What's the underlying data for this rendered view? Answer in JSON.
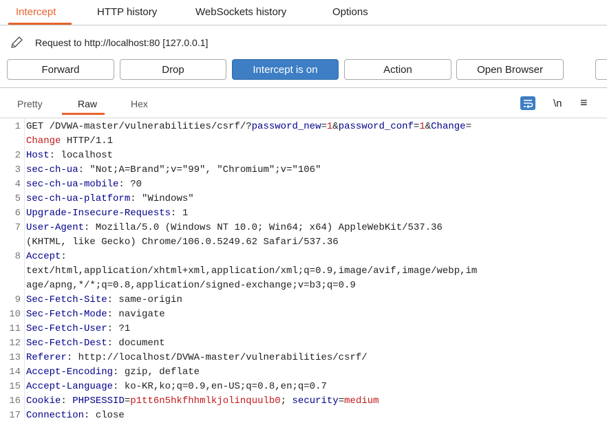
{
  "tabs": {
    "intercept": "Intercept",
    "http_history": "HTTP history",
    "websockets_history": "WebSockets history",
    "options": "Options"
  },
  "request": {
    "label": "Request to http://localhost:80  [127.0.0.1]"
  },
  "buttons": {
    "forward": "Forward",
    "drop": "Drop",
    "intercept": "Intercept is on",
    "action": "Action",
    "open_browser": "Open Browser"
  },
  "view_tabs": {
    "pretty": "Pretty",
    "raw": "Raw",
    "hex": "Hex",
    "newline": "\\n",
    "menu": "≡"
  },
  "editor": {
    "line1": {
      "method": "GET /DVWA-master/vulnerabilities/csrf/?",
      "p1": "password_new",
      "eq1": "=",
      "v1": "1",
      "amp1": "&",
      "p2": "password_conf",
      "eq2": "=",
      "v2": "1",
      "amp2": "&",
      "p3": "Change",
      "eq3": "="
    },
    "line1b": {
      "v3": "Change",
      "rest": " HTTP/1.1"
    },
    "headers": [
      {
        "n": "2",
        "k": "Host",
        "v": " localhost"
      },
      {
        "n": "3",
        "k": "sec-ch-ua",
        "v": " \"Not;A=Brand\";v=\"99\", \"Chromium\";v=\"106\""
      },
      {
        "n": "4",
        "k": "sec-ch-ua-mobile",
        "v": " ?0"
      },
      {
        "n": "5",
        "k": "sec-ch-ua-platform",
        "v": " \"Windows\""
      },
      {
        "n": "6",
        "k": "Upgrade-Insecure-Requests",
        "v": " 1"
      },
      {
        "n": "7",
        "k": "User-Agent",
        "v": " Mozilla/5.0 (Windows NT 10.0; Win64; x64) AppleWebKit/537.36"
      }
    ],
    "ua_cont": "(KHTML, like Gecko) Chrome/106.0.5249.62 Safari/537.36",
    "accept_key": "Accept",
    "accept_l1": "text/html,application/xhtml+xml,application/xml;q=0.9,image/avif,image/webp,im",
    "accept_l2": "age/apng,*/*;q=0.8,application/signed-exchange;v=b3;q=0.9",
    "headers2": [
      {
        "n": "9",
        "k": "Sec-Fetch-Site",
        "v": " same-origin"
      },
      {
        "n": "10",
        "k": "Sec-Fetch-Mode",
        "v": " navigate"
      },
      {
        "n": "11",
        "k": "Sec-Fetch-User",
        "v": " ?1"
      },
      {
        "n": "12",
        "k": "Sec-Fetch-Dest",
        "v": " document"
      },
      {
        "n": "13",
        "k": "Referer",
        "v": " http://localhost/DVWA-master/vulnerabilities/csrf/"
      },
      {
        "n": "14",
        "k": "Accept-Encoding",
        "v": " gzip, deflate"
      },
      {
        "n": "15",
        "k": "Accept-Language",
        "v": " ko-KR,ko;q=0.9,en-US;q=0.8,en;q=0.7"
      }
    ],
    "cookie": {
      "k": "Cookie",
      "c1k": "PHPSESSID",
      "c1v": "p1tt6n5hkfhhmlkjolinquulb0",
      "sep": "; ",
      "c2k": "security",
      "c2v": "medium"
    },
    "connection": {
      "k": "Connection",
      "v": " close"
    }
  },
  "colors": {
    "accent": "#e8632d",
    "primary_button": "#3d7ec4",
    "header_key": "#00008b",
    "param_value": "#c11a1a"
  }
}
